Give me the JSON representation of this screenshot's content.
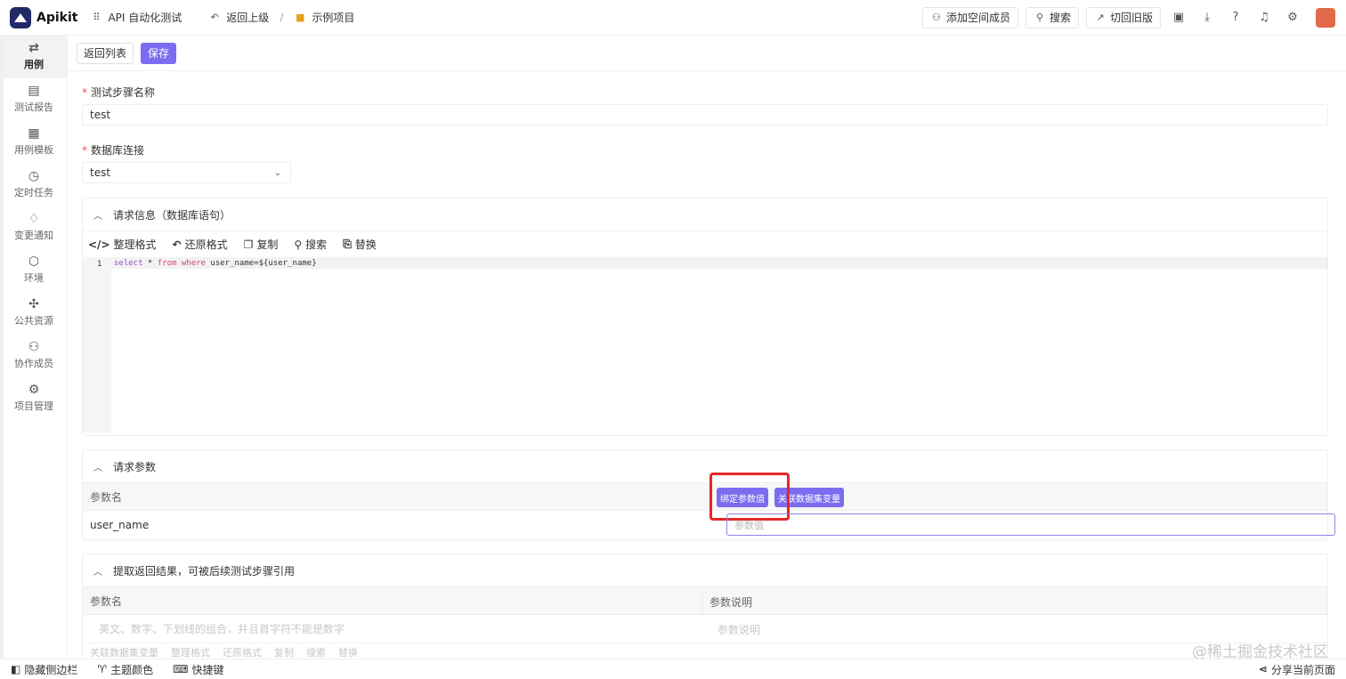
{
  "app": {
    "name": "Apikit"
  },
  "nav": {
    "workspace": "API 自动化测试",
    "back": "返回上级",
    "separator": "/",
    "project": "示例项目"
  },
  "topbar": {
    "add_member": "添加空间成员",
    "search": "搜索",
    "switch_old": "切回旧版"
  },
  "sidebar": {
    "items": [
      {
        "label": "用例",
        "icon": "⇄"
      },
      {
        "label": "测试报告",
        "icon": "▤"
      },
      {
        "label": "用例模板",
        "icon": "▦"
      },
      {
        "label": "定时任务",
        "icon": "◷"
      },
      {
        "label": "变更通知",
        "icon": "♢"
      },
      {
        "label": "环境",
        "icon": "⬡"
      },
      {
        "label": "公共资源",
        "icon": "✣"
      },
      {
        "label": "协作成员",
        "icon": "⚇"
      },
      {
        "label": "项目管理",
        "icon": "⚙"
      }
    ]
  },
  "actions": {
    "back_list": "返回列表",
    "save": "保存"
  },
  "form": {
    "step_name_label": "测试步骤名称",
    "step_name_value": "test",
    "db_label": "数据库连接",
    "db_value": "test",
    "required_mark": "*"
  },
  "request_info": {
    "title": "请求信息（数据库语句）",
    "tools": [
      "整理格式",
      "还原格式",
      "复制",
      "搜索",
      "替换"
    ],
    "line_number": "1",
    "code": {
      "k1": "select",
      "op": " * ",
      "k2": "from",
      "k3": " where ",
      "rest": "user_name=${user_name}"
    }
  },
  "request_params": {
    "title": "请求参数",
    "col_name": "参数名",
    "bind_button": "绑定参数值",
    "link_button": "关联数据集变量",
    "row_name": "user_name",
    "value_placeholder": "参数值"
  },
  "extract": {
    "title": "提取返回结果，可被后续测试步骤引用",
    "col_name": "参数名",
    "col_desc": "参数说明",
    "name_placeholder": "英文、数字、下划线的组合，并且首字符不能是数字",
    "desc_placeholder": "参数说明",
    "faded_tools": [
      "关联数据集变量",
      "整理格式",
      "还原格式",
      "复制",
      "搜索",
      "替换"
    ]
  },
  "bottom": {
    "hide_sidebar": "隐藏侧边栏",
    "theme": "主题颜色",
    "shortcuts": "快捷键",
    "share": "分享当前页面"
  },
  "watermark": "@稀土掘金技术社区",
  "colors": {
    "primary": "#7b6cf0",
    "required": "#f04d4d",
    "highlight": "#e62626"
  }
}
